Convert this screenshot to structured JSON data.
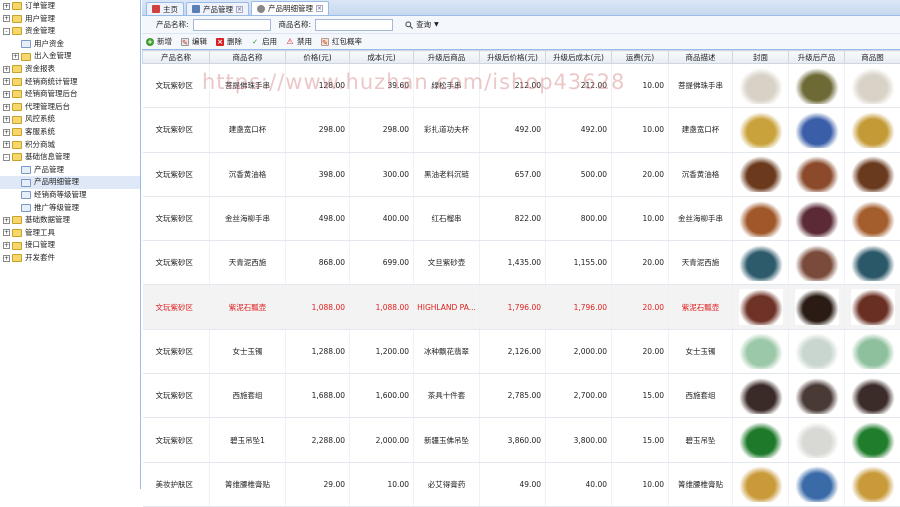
{
  "sidebar": {
    "items": [
      {
        "label": "订单管理",
        "level": 0,
        "exp": "+",
        "icon": "folder-icon"
      },
      {
        "label": "用户管理",
        "level": 0,
        "exp": "+",
        "icon": "folder-icon"
      },
      {
        "label": "资金管理",
        "level": 0,
        "exp": "-",
        "icon": "folder-icon"
      },
      {
        "label": "用户资金",
        "level": 1,
        "exp": "",
        "icon": "page-icon"
      },
      {
        "label": "出入金管理",
        "level": 1,
        "exp": "+",
        "icon": "folder-icon"
      },
      {
        "label": "资金报表",
        "level": 0,
        "exp": "+",
        "icon": "folder-icon"
      },
      {
        "label": "经销商统计管理",
        "level": 0,
        "exp": "+",
        "icon": "folder-icon"
      },
      {
        "label": "经销商管理后台",
        "level": 0,
        "exp": "+",
        "icon": "folder-icon"
      },
      {
        "label": "代理管理后台",
        "level": 0,
        "exp": "+",
        "icon": "folder-icon"
      },
      {
        "label": "风控系统",
        "level": 0,
        "exp": "+",
        "icon": "folder-icon"
      },
      {
        "label": "客服系统",
        "level": 0,
        "exp": "+",
        "icon": "folder-icon"
      },
      {
        "label": "积分商城",
        "level": 0,
        "exp": "+",
        "icon": "folder-icon"
      },
      {
        "label": "基础信息管理",
        "level": 0,
        "exp": "-",
        "icon": "folder-icon"
      },
      {
        "label": "产品管理",
        "level": 1,
        "exp": "",
        "icon": "page-icon"
      },
      {
        "label": "产品明细管理",
        "level": 1,
        "exp": "",
        "icon": "page-icon",
        "selected": true
      },
      {
        "label": "经销商等级管理",
        "level": 1,
        "exp": "",
        "icon": "page-icon"
      },
      {
        "label": "推广等级管理",
        "level": 1,
        "exp": "",
        "icon": "page-icon"
      },
      {
        "label": "基础数据管理",
        "level": 0,
        "exp": "+",
        "icon": "folder-icon"
      },
      {
        "label": "管理工具",
        "level": 0,
        "exp": "+",
        "icon": "folder-icon"
      },
      {
        "label": "接口管理",
        "level": 0,
        "exp": "+",
        "icon": "folder-icon"
      },
      {
        "label": "开发套件",
        "level": 0,
        "exp": "+",
        "icon": "folder-icon"
      }
    ]
  },
  "tabs": [
    {
      "label": "主页",
      "closable": false,
      "active": false,
      "icon": "home-icon"
    },
    {
      "label": "产品管理",
      "closable": true,
      "active": false,
      "icon": "page-icon"
    },
    {
      "label": "产品明细管理",
      "closable": true,
      "active": true,
      "icon": "gear-icon"
    }
  ],
  "search": {
    "product_name_label": "产品名称:",
    "goods_name_label": "商品名称:",
    "query_label": "查询"
  },
  "toolbar": {
    "add": "新增",
    "edit": "编辑",
    "delete": "删除",
    "enable": "启用",
    "disable": "禁用",
    "redpack": "红包概率"
  },
  "watermark": "https://www.huzhan.com/ishop43628",
  "columns": [
    "产品名称",
    "商品名称",
    "价格(元)",
    "成本(元)",
    "升级后商品",
    "升级后价格(元)",
    "升级后成本(元)",
    "运费(元)",
    "商品描述",
    "封面",
    "升级后产品",
    "商品图"
  ],
  "rows": [
    {
      "product": "文玩紫砂区",
      "goods": "菩提佛珠手串",
      "price": "128.00",
      "cost": "39.60",
      "upgrade": "绿松手串",
      "uprice": "212.00",
      "ucost": "212.00",
      "ship": "10.00",
      "desc": "菩提佛珠手串",
      "imgs": [
        "#d8d2c6",
        "#6d6a36",
        "#d9d3c7"
      ]
    },
    {
      "product": "文玩紫砂区",
      "goods": "建盏宽口杯",
      "price": "298.00",
      "cost": "298.00",
      "upgrade": "彩扎道功夫杯",
      "uprice": "492.00",
      "ucost": "492.00",
      "ship": "10.00",
      "desc": "建盏宽口杯",
      "imgs": [
        "#c9a23b",
        "#3a5ea8",
        "#c39a36"
      ]
    },
    {
      "product": "文玩紫砂区",
      "goods": "沉香黄油格",
      "price": "398.00",
      "cost": "300.00",
      "upgrade": "黑油老料沉链",
      "uprice": "657.00",
      "ucost": "500.00",
      "ship": "20.00",
      "desc": "沉香黄油格",
      "imgs": [
        "#6b3a1d",
        "#8a4a2b",
        "#6a3a1e"
      ]
    },
    {
      "product": "文玩紫砂区",
      "goods": "金丝海柳手串",
      "price": "498.00",
      "cost": "400.00",
      "upgrade": "红石榴串",
      "uprice": "822.00",
      "ucost": "800.00",
      "ship": "10.00",
      "desc": "金丝海柳手串",
      "imgs": [
        "#a0582a",
        "#5b2a36",
        "#a45d2c"
      ]
    },
    {
      "product": "文玩紫砂区",
      "goods": "天青泥西施",
      "price": "868.00",
      "cost": "699.00",
      "upgrade": "文旦紫砂壶",
      "uprice": "1,435.00",
      "ucost": "1,155.00",
      "ship": "20.00",
      "desc": "天青泥西施",
      "imgs": [
        "#2d5b6c",
        "#7a4a3a",
        "#2b5868"
      ]
    },
    {
      "product": "文玩紫砂区",
      "goods": "紫泥石瓢壶",
      "price": "1,088.00",
      "cost": "1,088.00",
      "upgrade": "HIGHLAND PA...",
      "uprice": "1,796.00",
      "ucost": "1,796.00",
      "ship": "20.00",
      "desc": "紫泥石瓢壶",
      "imgs": [
        "#6e3226",
        "#2a1c14",
        "#6a2f23"
      ],
      "red": true
    },
    {
      "product": "文玩紫砂区",
      "goods": "女士玉镯",
      "price": "1,288.00",
      "cost": "1,200.00",
      "upgrade": "冰种飘花翡翠",
      "uprice": "2,126.00",
      "ucost": "2,000.00",
      "ship": "20.00",
      "desc": "女士玉镯",
      "imgs": [
        "#9bc8a8",
        "#c9d6cf",
        "#8fc09d"
      ]
    },
    {
      "product": "文玩紫砂区",
      "goods": "西施套组",
      "price": "1,688.00",
      "cost": "1,600.00",
      "upgrade": "茶具十件套",
      "uprice": "2,785.00",
      "ucost": "2,700.00",
      "ship": "15.00",
      "desc": "西施套组",
      "imgs": [
        "#3a2a28",
        "#4a3a36",
        "#3b2b29"
      ]
    },
    {
      "product": "文玩紫砂区",
      "goods": "碧玉吊坠1",
      "price": "2,288.00",
      "cost": "2,000.00",
      "upgrade": "新疆玉佛吊坠",
      "uprice": "3,860.00",
      "ucost": "3,800.00",
      "ship": "15.00",
      "desc": "碧玉吊坠",
      "imgs": [
        "#1e7a2a",
        "#d8d8d4",
        "#1f7d2c"
      ]
    },
    {
      "product": "美妆护肤区",
      "goods": "箐维腰椎膏贴",
      "price": "29.00",
      "cost": "10.00",
      "upgrade": "必艾得膏药",
      "uprice": "49.00",
      "ucost": "40.00",
      "ship": "10.00",
      "desc": "箐维腰椎膏贴",
      "imgs": [
        "#c99a3a",
        "#3a6aa8",
        "#c89a3a"
      ]
    }
  ]
}
